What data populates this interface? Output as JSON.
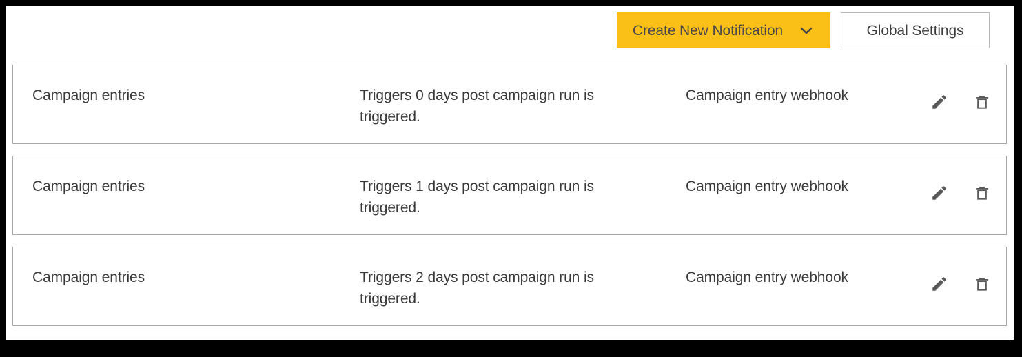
{
  "toolbar": {
    "create_label": "Create New Notification",
    "create_icon": "chevron-down-icon",
    "create_bg": "#FAC017",
    "settings_label": "Global Settings"
  },
  "notifications": [
    {
      "name": "Campaign entries",
      "description": "Triggers 0 days post campaign run is triggered.",
      "target": "Campaign entry webhook",
      "edit_icon": "pencil-icon",
      "delete_icon": "trash-icon"
    },
    {
      "name": "Campaign entries",
      "description": "Triggers 1 days post campaign run is triggered.",
      "target": "Campaign entry webhook",
      "edit_icon": "pencil-icon",
      "delete_icon": "trash-icon"
    },
    {
      "name": "Campaign entries",
      "description": "Triggers 2 days post campaign run is triggered.",
      "target": "Campaign entry webhook",
      "edit_icon": "pencil-icon",
      "delete_icon": "trash-icon"
    }
  ]
}
